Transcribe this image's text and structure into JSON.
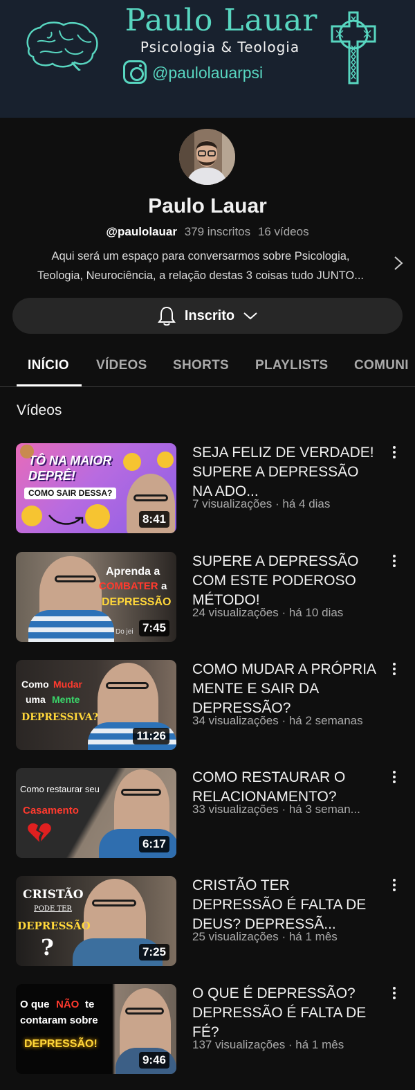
{
  "banner": {
    "title": "Paulo Lauar",
    "subtitle": "Psicologia & Teologia",
    "instagram": "@paulolauarpsi"
  },
  "channel": {
    "name": "Paulo Lauar",
    "handle": "@paulolauar",
    "subscribers": "379 inscritos",
    "video_count": "16 vídeos",
    "description_line1": "Aqui será um espaço para conversarmos sobre Psicologia,",
    "description_line2": "Teologia, Neurociência, a relação destas 3 coisas tudo JUNTO..."
  },
  "subscribe": {
    "label": "Inscrito"
  },
  "tabs": [
    {
      "label": "INÍCIO",
      "active": true
    },
    {
      "label": "VÍDEOS"
    },
    {
      "label": "SHORTS"
    },
    {
      "label": "PLAYLISTS"
    },
    {
      "label": "COMUNI"
    }
  ],
  "section": {
    "title": "Vídeos"
  },
  "thumb_text": {
    "v1_a": "TÔ NA MAIOR",
    "v1_b": "DEPRÊ!",
    "v1_c": "COMO SAIR DESSA?",
    "v2_a": "Aprenda a",
    "v2_b": "COMBATER",
    "v2_c": "a",
    "v2_d": "DEPRESSÃO",
    "v2_e": "Do jei",
    "v3_a": "Como",
    "v3_b": "Mudar",
    "v3_c": "uma",
    "v3_d": "Mente",
    "v3_e": "DEPRESSIVA?",
    "v4_a": "Como restaurar seu",
    "v4_b": "Casamento",
    "v5_a": "CRISTÃO",
    "v5_b": "PODE TER",
    "v5_c": "DEPRESSÃO",
    "v5_d": "?",
    "v6_a": "O que",
    "v6_b": "NÃO",
    "v6_c": "te",
    "v6_d": "contaram sobre",
    "v6_e": "DEPRESSÃO!"
  },
  "videos": [
    {
      "title": "SEJA FELIZ DE VERDADE! SUPERE A DEPRESSÃO NA ADO...",
      "meta": "7 visualizações · há 4 dias",
      "duration": "8:41"
    },
    {
      "title": "SUPERE A DEPRESSÃO COM ESTE PODEROSO MÉTODO!",
      "meta": "24 visualizações · há 10 dias",
      "duration": "7:45"
    },
    {
      "title": "COMO MUDAR A PRÓPRIA MENTE E SAIR DA DEPRESSÃO?",
      "meta": "34 visualizações · há 2 semanas",
      "duration": "11:26"
    },
    {
      "title": "COMO RESTAURAR O RELACIONAMENTO?",
      "meta": "33 visualizações · há 3 seman...",
      "duration": "6:17"
    },
    {
      "title": "CRISTÃO TER DEPRESSÃO É FALTA DE DEUS? DEPRESSÃ...",
      "meta": "25 visualizações · há 1 mês",
      "duration": "7:25"
    },
    {
      "title": "O QUE É DEPRESSÃO? DEPRESSÃO É FALTA DE FÉ?",
      "meta": "137 visualizações · há 1 mês",
      "duration": "9:46"
    }
  ]
}
